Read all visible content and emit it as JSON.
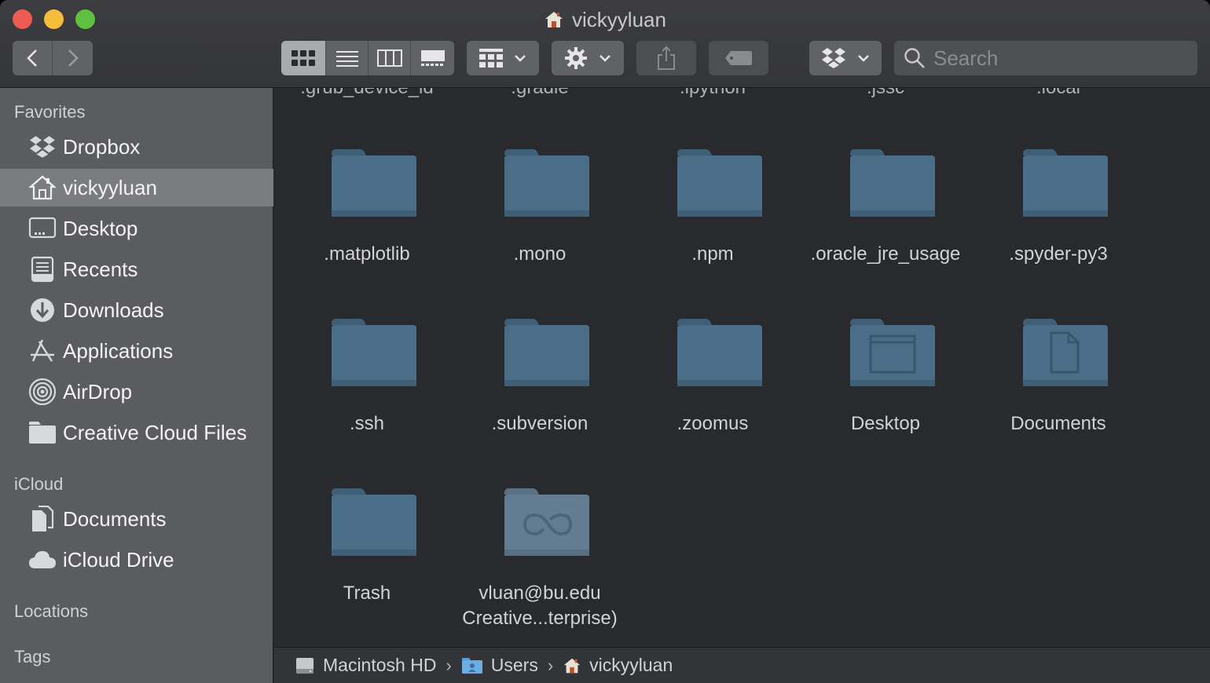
{
  "window": {
    "title": "vickyyluan"
  },
  "toolbar": {
    "search_placeholder": "Search",
    "view_modes": [
      "icon-view",
      "list-view",
      "column-view",
      "gallery-view"
    ]
  },
  "sidebar": {
    "favorites_header": "Favorites",
    "favorites": [
      {
        "label": "Dropbox",
        "icon": "dropbox-icon"
      },
      {
        "label": "vickyyluan",
        "icon": "home-icon",
        "selected": true
      },
      {
        "label": "Desktop",
        "icon": "desktop-icon"
      },
      {
        "label": "Recents",
        "icon": "recents-icon"
      },
      {
        "label": "Downloads",
        "icon": "downloads-icon"
      },
      {
        "label": "Applications",
        "icon": "applications-icon"
      },
      {
        "label": "AirDrop",
        "icon": "airdrop-icon"
      },
      {
        "label": "Creative Cloud Files",
        "icon": "folder-icon"
      }
    ],
    "icloud_header": "iCloud",
    "icloud": [
      {
        "label": "Documents",
        "icon": "documents-icon"
      },
      {
        "label": "iCloud Drive",
        "icon": "cloud-icon"
      }
    ],
    "locations_header": "Locations",
    "tags_header": "Tags"
  },
  "main": {
    "cut_labels": [
      ".grub_device_id",
      ".gradle",
      ".ipython",
      ".jssc",
      ".local"
    ],
    "rows": [
      [
        {
          "label": ".matplotlib",
          "kind": "folder"
        },
        {
          "label": ".mono",
          "kind": "folder"
        },
        {
          "label": ".npm",
          "kind": "folder"
        },
        {
          "label": ".oracle_jre_usage",
          "kind": "folder"
        },
        {
          "label": ".spyder-py3",
          "kind": "folder"
        }
      ],
      [
        {
          "label": ".ssh",
          "kind": "folder"
        },
        {
          "label": ".subversion",
          "kind": "folder"
        },
        {
          "label": ".zoomus",
          "kind": "folder"
        },
        {
          "label": "Desktop",
          "kind": "desktop-folder"
        },
        {
          "label": "Documents",
          "kind": "documents-folder"
        }
      ],
      [
        {
          "label": "Trash",
          "kind": "folder"
        },
        {
          "label": "vluan@bu.edu Creative...terprise)",
          "kind": "cc-folder",
          "line1": "vluan@bu.edu",
          "line2": "Creative...terprise)"
        }
      ]
    ]
  },
  "pathbar": {
    "crumbs": [
      {
        "label": "Macintosh HD",
        "icon": "hard-drive-icon"
      },
      {
        "label": "Users",
        "icon": "users-folder-icon"
      },
      {
        "label": "vickyyluan",
        "icon": "home-icon"
      }
    ]
  }
}
